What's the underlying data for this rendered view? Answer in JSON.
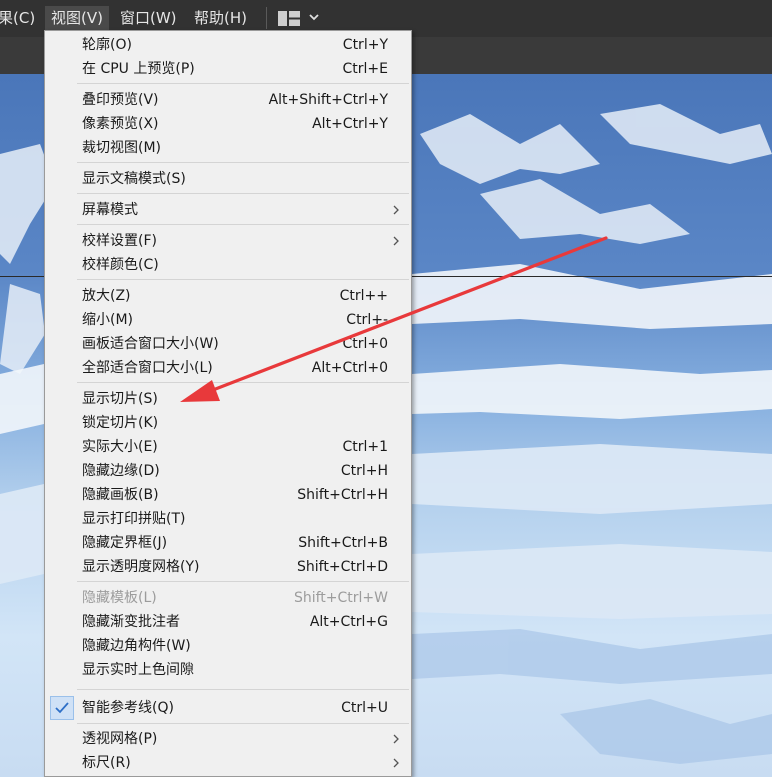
{
  "menubar": {
    "items": [
      {
        "label": "果(C)"
      },
      {
        "label": "视图(V)"
      },
      {
        "label": "窗口(W)"
      },
      {
        "label": "帮助(H)"
      }
    ],
    "workspace_icon": "layout-grid-icon",
    "workspace_chevron": "chevron-down-icon"
  },
  "menu": {
    "items": [
      {
        "label": "轮廓(O)",
        "shortcut": "Ctrl+Y"
      },
      {
        "label": "在 CPU 上预览(P)",
        "shortcut": "Ctrl+E"
      },
      {
        "label": "叠印预览(V)",
        "shortcut": "Alt+Shift+Ctrl+Y"
      },
      {
        "label": "像素预览(X)",
        "shortcut": "Alt+Ctrl+Y"
      },
      {
        "label": "裁切视图(M)",
        "shortcut": ""
      },
      {
        "label": "显示文稿模式(S)",
        "shortcut": ""
      },
      {
        "label": "屏幕模式",
        "shortcut": "",
        "submenu": true
      },
      {
        "label": "校样设置(F)",
        "shortcut": "",
        "submenu": true
      },
      {
        "label": "校样颜色(C)",
        "shortcut": ""
      },
      {
        "label": "放大(Z)",
        "shortcut": "Ctrl++"
      },
      {
        "label": "缩小(M)",
        "shortcut": "Ctrl+-"
      },
      {
        "label": "画板适合窗口大小(W)",
        "shortcut": "Ctrl+0"
      },
      {
        "label": "全部适合窗口大小(L)",
        "shortcut": "Alt+Ctrl+0"
      },
      {
        "label": "显示切片(S)",
        "shortcut": ""
      },
      {
        "label": "锁定切片(K)",
        "shortcut": ""
      },
      {
        "label": "实际大小(E)",
        "shortcut": "Ctrl+1"
      },
      {
        "label": "隐藏边缘(D)",
        "shortcut": "Ctrl+H"
      },
      {
        "label": "隐藏画板(B)",
        "shortcut": "Shift+Ctrl+H"
      },
      {
        "label": "显示打印拼贴(T)",
        "shortcut": ""
      },
      {
        "label": "隐藏定界框(J)",
        "shortcut": "Shift+Ctrl+B"
      },
      {
        "label": "显示透明度网格(Y)",
        "shortcut": "Shift+Ctrl+D"
      },
      {
        "label": "隐藏模板(L)",
        "shortcut": "Shift+Ctrl+W",
        "disabled": true
      },
      {
        "label": "隐藏渐变批注者",
        "shortcut": "Alt+Ctrl+G"
      },
      {
        "label": "隐藏边角构件(W)",
        "shortcut": ""
      },
      {
        "label": "显示实时上色间隙",
        "shortcut": ""
      },
      {
        "label": "智能参考线(Q)",
        "shortcut": "Ctrl+U",
        "checked": true
      },
      {
        "label": "透视网格(P)",
        "shortcut": "",
        "submenu": true
      },
      {
        "label": "标尺(R)",
        "shortcut": "",
        "submenu": true
      }
    ],
    "check_icon": "checkmark-icon",
    "submenu_icon": "chevron-right-icon"
  },
  "annotation": {
    "arrow_color": "#e8393b",
    "points_to": "显示切片(S)"
  },
  "colors": {
    "menubar_bg": "#323232",
    "menu_bg": "#f0f0f0",
    "checked_bg": "#cfe1f6",
    "check_color": "#2d6fc7"
  }
}
